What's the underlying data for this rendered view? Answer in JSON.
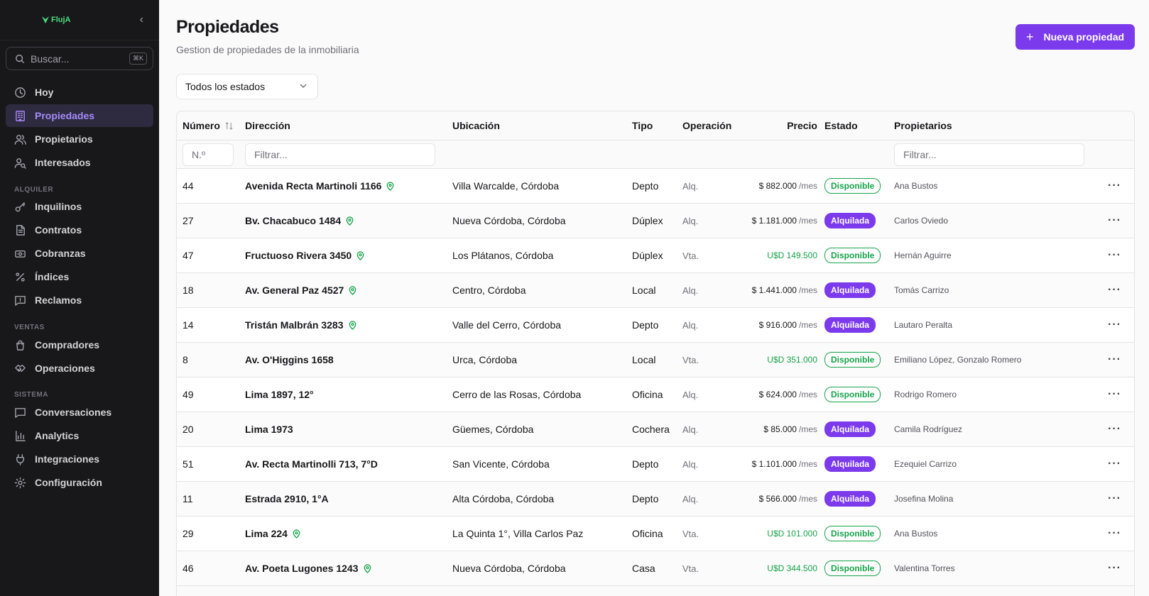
{
  "app": {
    "logo_text": "FlujA",
    "brand_color": "#4ade80",
    "accent_color": "#7c3aed"
  },
  "sidebar": {
    "search_placeholder": "Buscar...",
    "search_shortcut": "⌘K",
    "items": [
      {
        "label": "Hoy",
        "icon": "clock-icon"
      },
      {
        "label": "Propiedades",
        "icon": "building-icon",
        "active": true
      },
      {
        "label": "Propietarios",
        "icon": "users-icon"
      },
      {
        "label": "Interesados",
        "icon": "user-search-icon"
      }
    ],
    "section_alquiler": "ALQUILER",
    "alquiler_items": [
      {
        "label": "Inquilinos",
        "icon": "key-icon"
      },
      {
        "label": "Contratos",
        "icon": "file-text-icon"
      },
      {
        "label": "Cobranzas",
        "icon": "banknote-icon"
      },
      {
        "label": "Índices",
        "icon": "percent-icon"
      },
      {
        "label": "Reclamos",
        "icon": "alert-message-icon"
      }
    ],
    "section_ventas": "VENTAS",
    "ventas_items": [
      {
        "label": "Compradores",
        "icon": "shopping-bag-icon"
      },
      {
        "label": "Operaciones",
        "icon": "handshake-icon"
      }
    ],
    "section_sistema": "SISTEMA",
    "sistema_items": [
      {
        "label": "Conversaciones",
        "icon": "message-square-icon"
      },
      {
        "label": "Analytics",
        "icon": "bar-chart-icon"
      },
      {
        "label": "Integraciones",
        "icon": "plug-icon"
      },
      {
        "label": "Configuración",
        "icon": "gear-icon"
      }
    ]
  },
  "header": {
    "title": "Propiedades",
    "subtitle": "Gestion de propiedades de la inmobiliaria",
    "new_button": "Nueva propiedad",
    "state_filter": "Todos los estados"
  },
  "table": {
    "columns": {
      "numero": "Número",
      "direccion": "Dirección",
      "ubicacion": "Ubicación",
      "tipo": "Tipo",
      "operacion": "Operación",
      "precio": "Precio",
      "estado": "Estado",
      "propietarios": "Propietarios"
    },
    "filters": {
      "numero_placeholder": "N.º",
      "direccion_placeholder": "Filtrar...",
      "propietarios_placeholder": "Filtrar..."
    },
    "rows": [
      {
        "num": "44",
        "dir": "Avenida Recta Martinoli 1166",
        "pin": true,
        "ubi": "Villa Warcalde, Córdoba",
        "tipo": "Depto",
        "op": "Alq.",
        "precio": "$ 882.000",
        "mes": "/mes",
        "usd": false,
        "estado": "Disponible",
        "prop": "Ana Bustos"
      },
      {
        "num": "27",
        "dir": "Bv. Chacabuco 1484",
        "pin": true,
        "ubi": "Nueva Córdoba, Córdoba",
        "tipo": "Dúplex",
        "op": "Alq.",
        "precio": "$ 1.181.000",
        "mes": "/mes",
        "usd": false,
        "estado": "Alquilada",
        "prop": "Carlos Oviedo"
      },
      {
        "num": "47",
        "dir": "Fructuoso Rivera 3450",
        "pin": true,
        "ubi": "Los Plátanos, Córdoba",
        "tipo": "Dúplex",
        "op": "Vta.",
        "precio": "U$D 149.500",
        "mes": "",
        "usd": true,
        "estado": "Disponible",
        "prop": "Hernán Aguirre"
      },
      {
        "num": "18",
        "dir": "Av. General Paz 4527",
        "pin": true,
        "ubi": "Centro, Córdoba",
        "tipo": "Local",
        "op": "Alq.",
        "precio": "$ 1.441.000",
        "mes": "/mes",
        "usd": false,
        "estado": "Alquilada",
        "prop": "Tomás Carrizo"
      },
      {
        "num": "14",
        "dir": "Tristán Malbrán 3283",
        "pin": true,
        "ubi": "Valle del Cerro, Córdoba",
        "tipo": "Depto",
        "op": "Alq.",
        "precio": "$ 916.000",
        "mes": "/mes",
        "usd": false,
        "estado": "Alquilada",
        "prop": "Lautaro Peralta"
      },
      {
        "num": "8",
        "dir": "Av. O'Higgins 1658",
        "pin": false,
        "ubi": "Urca, Córdoba",
        "tipo": "Local",
        "op": "Vta.",
        "precio": "U$D 351.000",
        "mes": "",
        "usd": true,
        "estado": "Disponible",
        "prop": "Emiliano López, Gonzalo Romero"
      },
      {
        "num": "49",
        "dir": "Lima 1897, 12°",
        "pin": false,
        "ubi": "Cerro de las Rosas, Córdoba",
        "tipo": "Oficina",
        "op": "Alq.",
        "precio": "$ 624.000",
        "mes": "/mes",
        "usd": false,
        "estado": "Disponible",
        "prop": "Rodrigo Romero"
      },
      {
        "num": "20",
        "dir": "Lima 1973",
        "pin": false,
        "ubi": "Güemes, Córdoba",
        "tipo": "Cochera",
        "op": "Alq.",
        "precio": "$ 85.000",
        "mes": "/mes",
        "usd": false,
        "estado": "Alquilada",
        "prop": "Camila Rodríguez"
      },
      {
        "num": "51",
        "dir": "Av. Recta Martinolli 713, 7°D",
        "pin": false,
        "ubi": "San Vicente, Córdoba",
        "tipo": "Depto",
        "op": "Alq.",
        "precio": "$ 1.101.000",
        "mes": "/mes",
        "usd": false,
        "estado": "Alquilada",
        "prop": "Ezequiel Carrizo"
      },
      {
        "num": "11",
        "dir": "Estrada 2910, 1°A",
        "pin": false,
        "ubi": "Alta Córdoba, Córdoba",
        "tipo": "Depto",
        "op": "Alq.",
        "precio": "$ 566.000",
        "mes": "/mes",
        "usd": false,
        "estado": "Alquilada",
        "prop": "Josefina Molina"
      },
      {
        "num": "29",
        "dir": "Lima 224",
        "pin": true,
        "ubi": "La Quinta 1°, Villa Carlos Paz",
        "tipo": "Oficina",
        "op": "Vta.",
        "precio": "U$D 101.000",
        "mes": "",
        "usd": true,
        "estado": "Disponible",
        "prop": "Ana Bustos"
      },
      {
        "num": "46",
        "dir": "Av. Poeta Lugones 1243",
        "pin": true,
        "ubi": "Nueva Córdoba, Córdoba",
        "tipo": "Casa",
        "op": "Vta.",
        "precio": "U$D 344.500",
        "mes": "",
        "usd": true,
        "estado": "Disponible",
        "prop": "Valentina Torres"
      }
    ]
  }
}
